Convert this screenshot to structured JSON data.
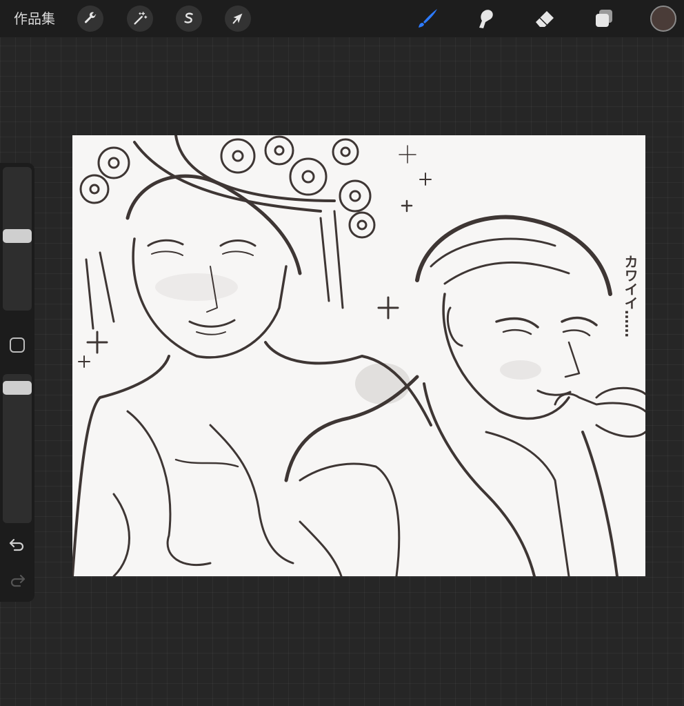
{
  "toolbar": {
    "gallery_label": "作品集",
    "left_tools": [
      {
        "name": "actions",
        "icon": "wrench-icon"
      },
      {
        "name": "adjustments",
        "icon": "magic-wand-icon"
      },
      {
        "name": "selection",
        "icon": "selection-s-icon"
      },
      {
        "name": "transform",
        "icon": "arrow-cursor-icon"
      }
    ],
    "right_tools": [
      {
        "name": "brush",
        "icon": "brush-icon",
        "active": true
      },
      {
        "name": "smudge",
        "icon": "smudge-finger-icon"
      },
      {
        "name": "eraser",
        "icon": "eraser-icon"
      },
      {
        "name": "layers",
        "icon": "layers-icon"
      }
    ],
    "current_color": "#4a3c38",
    "active_color": "#1f6fff"
  },
  "sidebar": {
    "brush_size_icon": "slider-icon",
    "modify_icon": "square-icon",
    "opacity_icon": "slider-icon",
    "undo_icon": "undo-icon",
    "redo_icon": "redo-icon"
  },
  "artwork": {
    "sfx_text": "カワイイ……",
    "description_icon": "sketch-artwork"
  }
}
